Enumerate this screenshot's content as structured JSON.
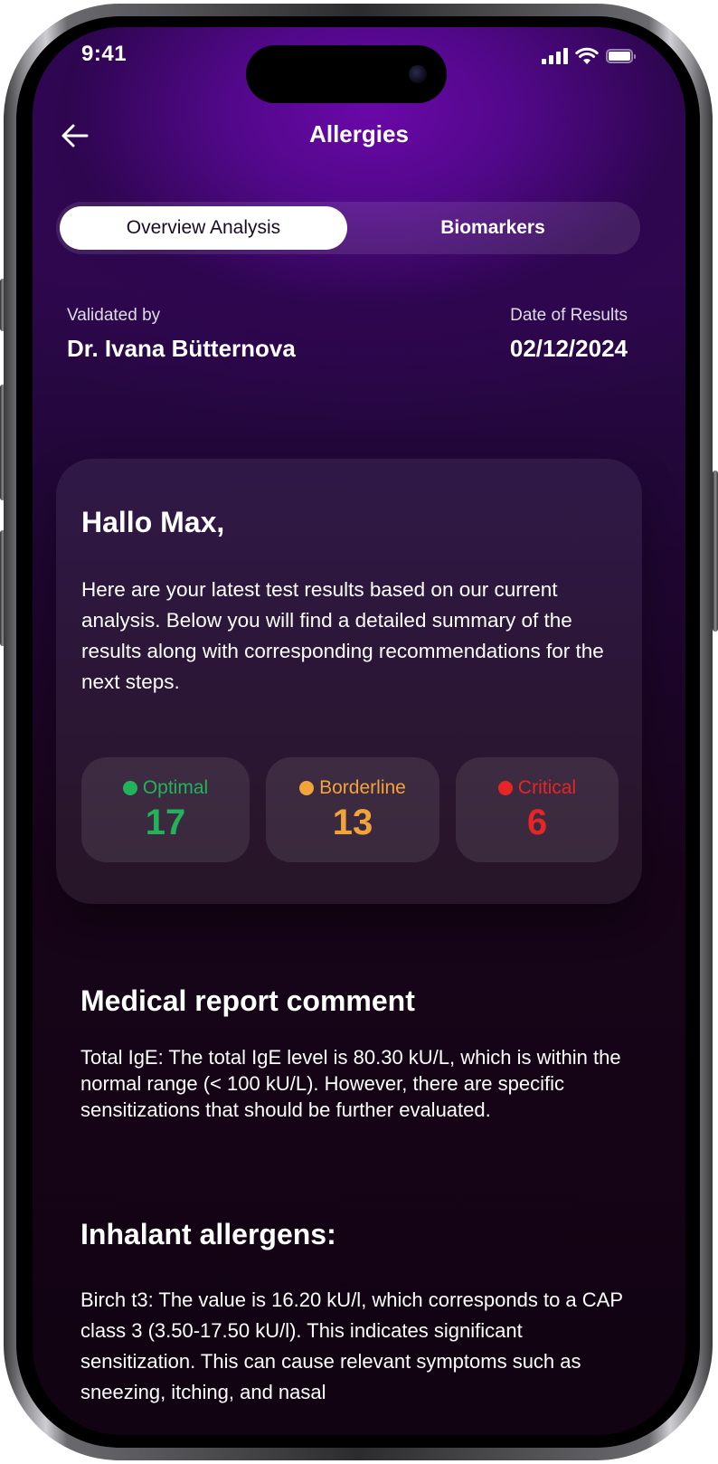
{
  "status_bar": {
    "time": "9:41",
    "icons": [
      "signal-icon",
      "wifi-icon",
      "battery-icon"
    ]
  },
  "header": {
    "title": "Allergies",
    "back_icon": "arrow-left-icon"
  },
  "tabs": [
    {
      "label": "Overview Analysis",
      "active": true
    },
    {
      "label": "Biomarkers",
      "active": false
    }
  ],
  "meta": {
    "validated_label": "Validated by",
    "validated_value": "Dr. Ivana Bütternova",
    "date_label": "Date of Results",
    "date_value": "02/12/2024"
  },
  "greeting": {
    "title": "Hallo Max,",
    "text": "Here are your latest test results based on our current analysis. Below you will find a detailed summary of the results along with corresponding recommendations for the next steps."
  },
  "stats": [
    {
      "label": "Optimal",
      "value": "17",
      "color": "#22b35a"
    },
    {
      "label": "Borderline",
      "value": "13",
      "color": "#f2a33a"
    },
    {
      "label": "Critical",
      "value": "6",
      "color": "#e62525"
    }
  ],
  "report": {
    "title": "Medical report comment",
    "text": "Total IgE: The total IgE level is 80.30 kU/L, which is within the normal range (< 100 kU/L). However, there are specific sensitizations that should be further evaluated."
  },
  "inhalant": {
    "title": "Inhalant allergens:",
    "text": "Birch t3: The value is 16.20 kU/l, which corresponds to a CAP class 3 (3.50-17.50 kU/l). This indicates significant sensitization. This can cause relevant symptoms such as sneezing, itching, and nasal"
  },
  "colors": {
    "accent_purple": "#5a089a",
    "background_dark": "#140316",
    "text_on_light": "#1a0b24"
  }
}
